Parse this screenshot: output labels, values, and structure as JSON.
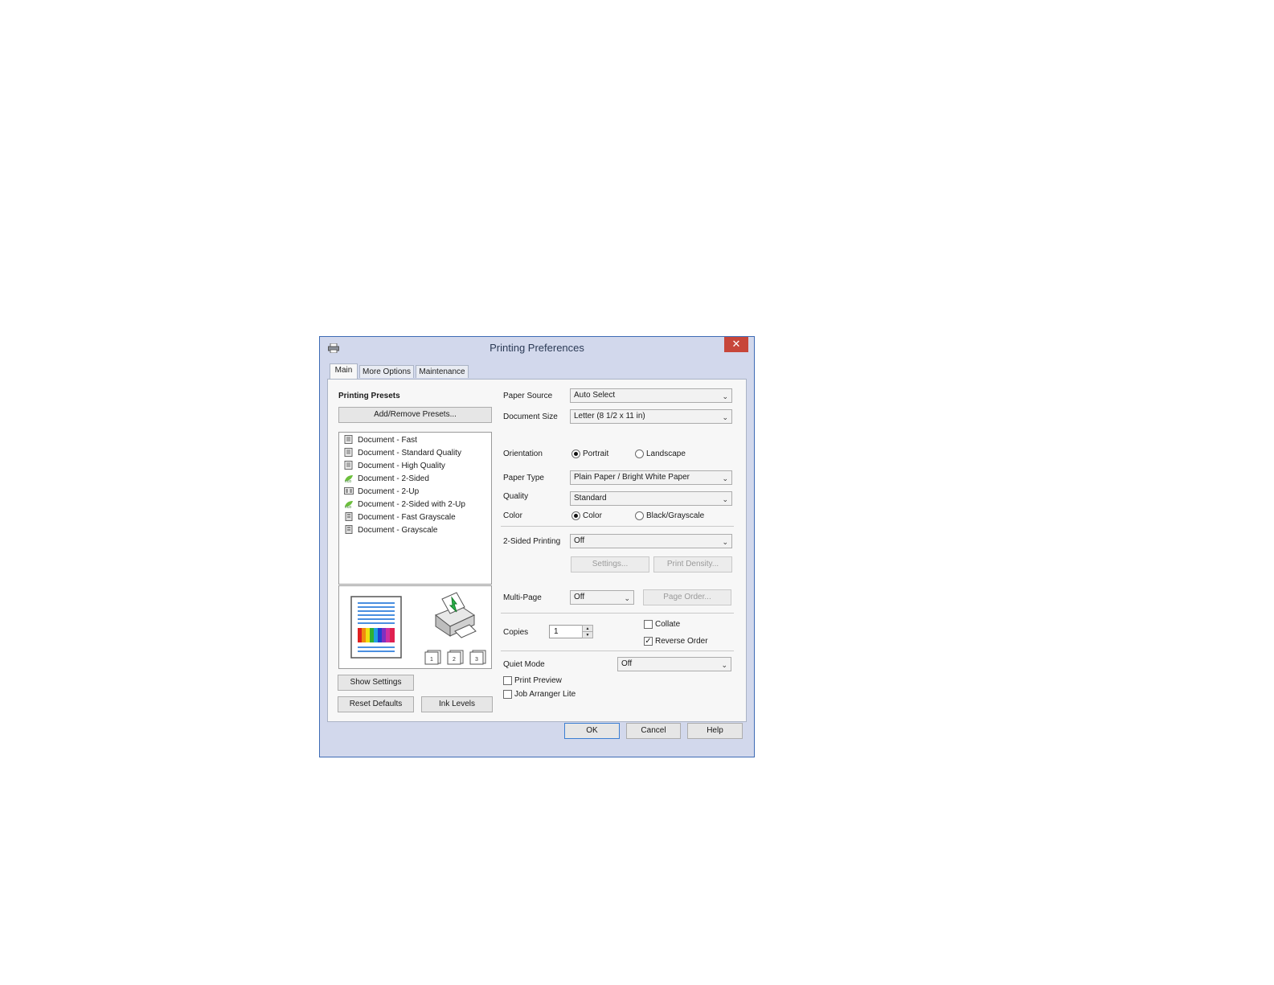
{
  "window": {
    "title": "Printing Preferences",
    "close_glyph": "✕",
    "accent": "#3e6bb5"
  },
  "tabs": [
    {
      "label": "Main",
      "active": true
    },
    {
      "label": "More Options",
      "active": false
    },
    {
      "label": "Maintenance",
      "active": false
    }
  ],
  "presets": {
    "heading": "Printing Presets",
    "add_remove_label": "Add/Remove Presets...",
    "items": [
      {
        "label": "Document - Fast",
        "icon": "document-icon"
      },
      {
        "label": "Document - Standard Quality",
        "icon": "document-icon"
      },
      {
        "label": "Document - High Quality",
        "icon": "document-icon"
      },
      {
        "label": "Document - 2-Sided",
        "icon": "eco-icon"
      },
      {
        "label": "Document - 2-Up",
        "icon": "two-up-icon"
      },
      {
        "label": "Document - 2-Sided with 2-Up",
        "icon": "eco-icon"
      },
      {
        "label": "Document - Fast Grayscale",
        "icon": "grayscale-document-icon"
      },
      {
        "label": "Document - Grayscale",
        "icon": "grayscale-document-icon"
      }
    ]
  },
  "left_buttons": {
    "show_settings": "Show Settings",
    "reset_defaults": "Reset Defaults",
    "ink_levels": "Ink Levels"
  },
  "settings": {
    "paper_source": {
      "label": "Paper Source",
      "value": "Auto Select"
    },
    "document_size": {
      "label": "Document Size",
      "value": "Letter (8 1/2 x 11 in)"
    },
    "orientation": {
      "label": "Orientation",
      "options": [
        "Portrait",
        "Landscape"
      ],
      "selected": "Portrait"
    },
    "paper_type": {
      "label": "Paper Type",
      "value": "Plain Paper / Bright White Paper"
    },
    "quality": {
      "label": "Quality",
      "value": "Standard"
    },
    "color": {
      "label": "Color",
      "options": [
        "Color",
        "Black/Grayscale"
      ],
      "selected": "Color"
    },
    "two_sided": {
      "label": "2-Sided Printing",
      "value": "Off",
      "settings_button": "Settings...",
      "print_density_button": "Print Density..."
    },
    "multi_page": {
      "label": "Multi-Page",
      "value": "Off",
      "page_order_button": "Page Order..."
    },
    "copies": {
      "label": "Copies",
      "value": "1"
    },
    "collate": {
      "label": "Collate",
      "checked": false
    },
    "reverse_order": {
      "label": "Reverse Order",
      "checked": true
    },
    "quiet_mode": {
      "label": "Quiet Mode",
      "value": "Off"
    },
    "print_preview": {
      "label": "Print Preview",
      "checked": false
    },
    "job_arranger": {
      "label": "Job Arranger Lite",
      "checked": false
    }
  },
  "dialog_buttons": {
    "ok": "OK",
    "cancel": "Cancel",
    "help": "Help"
  },
  "glyphs": {
    "dropdown": "⌄",
    "check": "✓",
    "spin_up": "▲",
    "spin_down": "▼"
  }
}
